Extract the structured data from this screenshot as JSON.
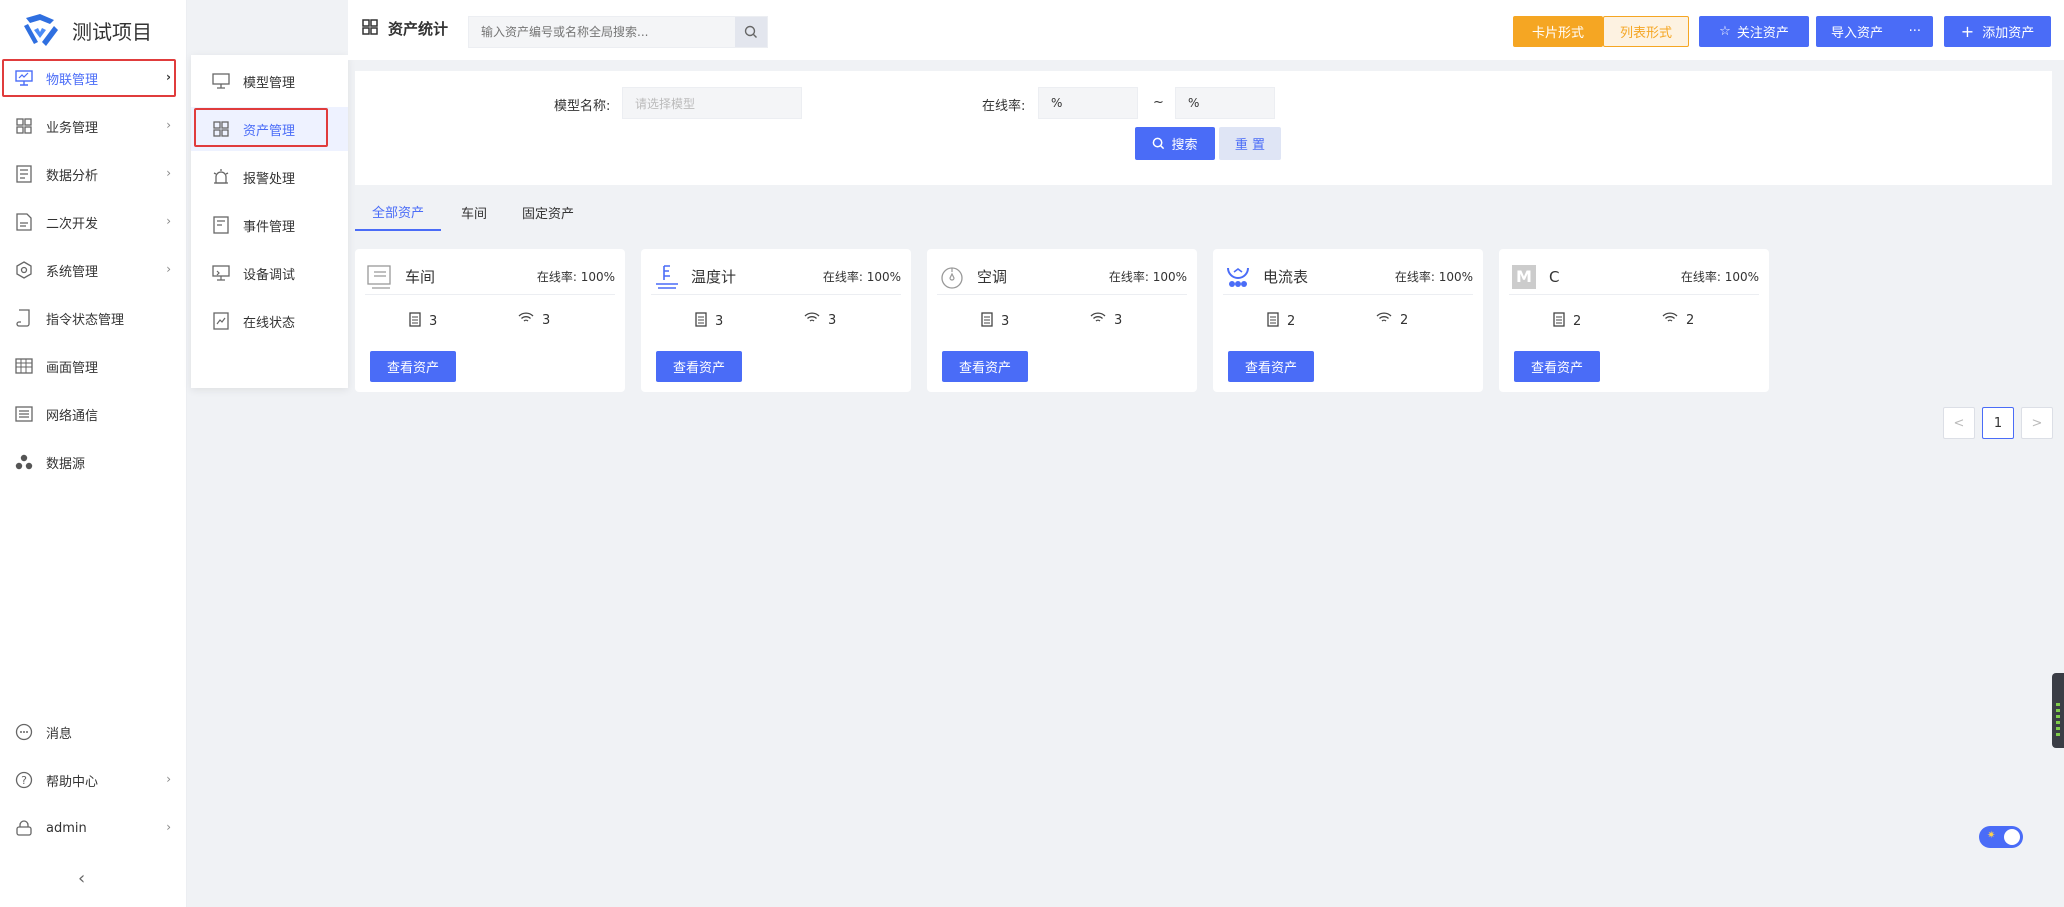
{
  "app": {
    "title": "测试项目"
  },
  "sidebar": {
    "items": [
      {
        "label": "物联管理",
        "icon": "monitor-icon",
        "active": true,
        "has_children": true
      },
      {
        "label": "业务管理",
        "icon": "grid-icon",
        "has_children": true
      },
      {
        "label": "数据分析",
        "icon": "document-chart-icon",
        "has_children": true
      },
      {
        "label": "二次开发",
        "icon": "code-doc-icon",
        "has_children": true
      },
      {
        "label": "系统管理",
        "icon": "gear-icon",
        "has_children": true
      },
      {
        "label": "指令状态管理",
        "icon": "scroll-icon",
        "has_children": false
      },
      {
        "label": "画面管理",
        "icon": "table-icon",
        "has_children": false
      },
      {
        "label": "网络通信",
        "icon": "list-icon",
        "has_children": false
      },
      {
        "label": "数据源",
        "icon": "cluster-icon",
        "has_children": false
      }
    ],
    "bottom": [
      {
        "label": "消息",
        "icon": "chat-icon"
      },
      {
        "label": "帮助中心",
        "icon": "help-icon"
      },
      {
        "label": "admin",
        "icon": "lock-icon"
      }
    ]
  },
  "submenu": {
    "items": [
      {
        "label": "模型管理",
        "icon": "model-icon"
      },
      {
        "label": "资产管理",
        "icon": "grid-icon",
        "active": true
      },
      {
        "label": "报警处理",
        "icon": "alarm-icon"
      },
      {
        "label": "事件管理",
        "icon": "event-icon"
      },
      {
        "label": "设备调试",
        "icon": "debug-icon"
      },
      {
        "label": "在线状态",
        "icon": "status-icon"
      }
    ]
  },
  "topbar": {
    "title": "资产统计",
    "search_placeholder": "输入资产编号或名称全局搜索...",
    "btn_card": "卡片形式",
    "btn_list": "列表形式",
    "btn_follow": "关注资产",
    "btn_import": "导入资产",
    "btn_more": "···",
    "btn_add": "添加资产"
  },
  "filter": {
    "model_label": "模型名称:",
    "model_placeholder": "请选择模型",
    "rate_label": "在线率:",
    "rate_from": "%",
    "rate_sep": "~",
    "rate_to": "%",
    "search_btn": "搜索",
    "reset_btn": "重 置"
  },
  "tabs": [
    "全部资产",
    "车间",
    "固定资产"
  ],
  "cards": [
    {
      "name": "车间",
      "rate_label": "在线率:",
      "rate": "100%",
      "devices": "3",
      "online": "3",
      "btn": "查看资产",
      "icon": "workshop-icon"
    },
    {
      "name": "温度计",
      "rate_label": "在线率:",
      "rate": "100%",
      "devices": "3",
      "online": "3",
      "btn": "查看资产",
      "icon": "thermometer-icon"
    },
    {
      "name": "空调",
      "rate_label": "在线率:",
      "rate": "100%",
      "devices": "3",
      "online": "3",
      "btn": "查看资产",
      "icon": "aircon-icon"
    },
    {
      "name": "电流表",
      "rate_label": "在线率:",
      "rate": "100%",
      "devices": "2",
      "online": "2",
      "btn": "查看资产",
      "icon": "ammeter-icon"
    },
    {
      "name": "C",
      "rate_label": "在线率:",
      "rate": "100%",
      "devices": "2",
      "online": "2",
      "btn": "查看资产",
      "icon": "letter-m-icon",
      "icon_text": "M"
    }
  ],
  "pagination": {
    "prev": "<",
    "current": "1",
    "next": ">"
  },
  "colors": {
    "primary": "#4a6cf7",
    "orange": "#f5a623",
    "highlight_box": "#e03c3c"
  }
}
